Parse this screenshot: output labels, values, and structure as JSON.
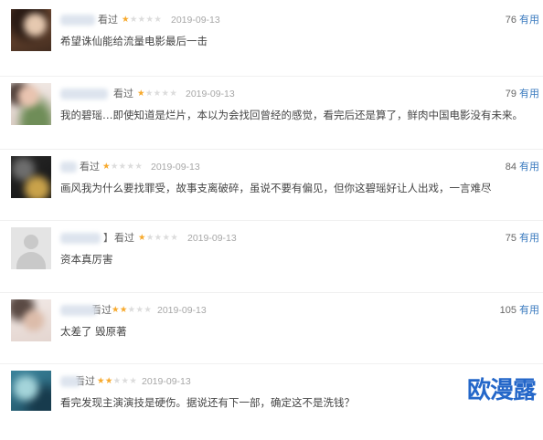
{
  "reviews": [
    {
      "status": "看过",
      "rating": 1,
      "date": "2019-09-13",
      "votes": "76",
      "votes_label": "有用",
      "comment": "希望诛仙能给流量电影最后一击"
    },
    {
      "status": "看过",
      "rating": 1,
      "date": "2019-09-13",
      "votes": "79",
      "votes_label": "有用",
      "comment": "我的碧瑶…即使知道是烂片，本以为会找回曾经的感觉，看完后还是算了，鲜肉中国电影没有未来。"
    },
    {
      "status": "看过",
      "rating": 1,
      "date": "2019-09-13",
      "votes": "84",
      "votes_label": "有用",
      "comment": "画风我为什么要找罪受，故事支离破碎，虽说不要有偏见，但你这碧瑶好让人出戏，一言难尽"
    },
    {
      "name_fragment": "】",
      "status": "看过",
      "rating": 1,
      "date": "2019-09-13",
      "votes": "75",
      "votes_label": "有用",
      "comment": "资本真厉害"
    },
    {
      "status": "看过",
      "rating": 2,
      "date": "2019-09-13",
      "votes": "105",
      "votes_label": "有用",
      "comment": "太差了 毁原著"
    },
    {
      "status": "看过",
      "rating": 2,
      "date": "2019-09-13",
      "comment": "看完发现主演演技是硬伤。据说还有下一部，确定这不是洗钱？"
    }
  ],
  "rating_max": 5,
  "watermark": "欧漫露",
  "icons": {
    "rating": "star-icon",
    "default_avatar": "default-avatar-icon"
  },
  "colors": {
    "link": "#3b7bbf",
    "star": "#f7a92c",
    "star_empty": "#dcdcdc",
    "watermark": "#2467c9"
  }
}
